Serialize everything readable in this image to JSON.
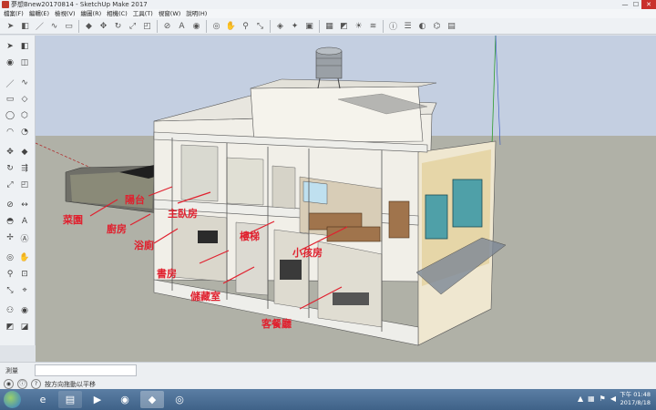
{
  "window": {
    "title": "夢想Bnew20170814 - SketchUp Make 2017",
    "btn_min": "—",
    "btn_max": "☐",
    "btn_close": "✕"
  },
  "menu": [
    "檔案(F)",
    "編輯(E)",
    "檢視(V)",
    "繪圖(R)",
    "相機(C)",
    "工具(T)",
    "視窗(W)",
    "說明(H)"
  ],
  "labels": {
    "vegetable_garden": "菜園",
    "balcony": "陽台",
    "kitchen": "廚房",
    "master_bedroom": "主臥房",
    "bathroom": "浴廁",
    "stairs": "樓梯",
    "kids_room": "小孩房",
    "study": "書房",
    "storage": "儲藏室",
    "living_room": "客餐廳"
  },
  "status": {
    "measure_label": "測量",
    "hint": "按方向拖動以平移"
  },
  "tray": {
    "time_prefix": "下午 01:48",
    "date": "2017/8/18"
  },
  "colors": {
    "sky": "#c4cfe1",
    "ground": "#b0b1a7",
    "wall": "#f4f4ef",
    "annotation": "#e0202e"
  }
}
